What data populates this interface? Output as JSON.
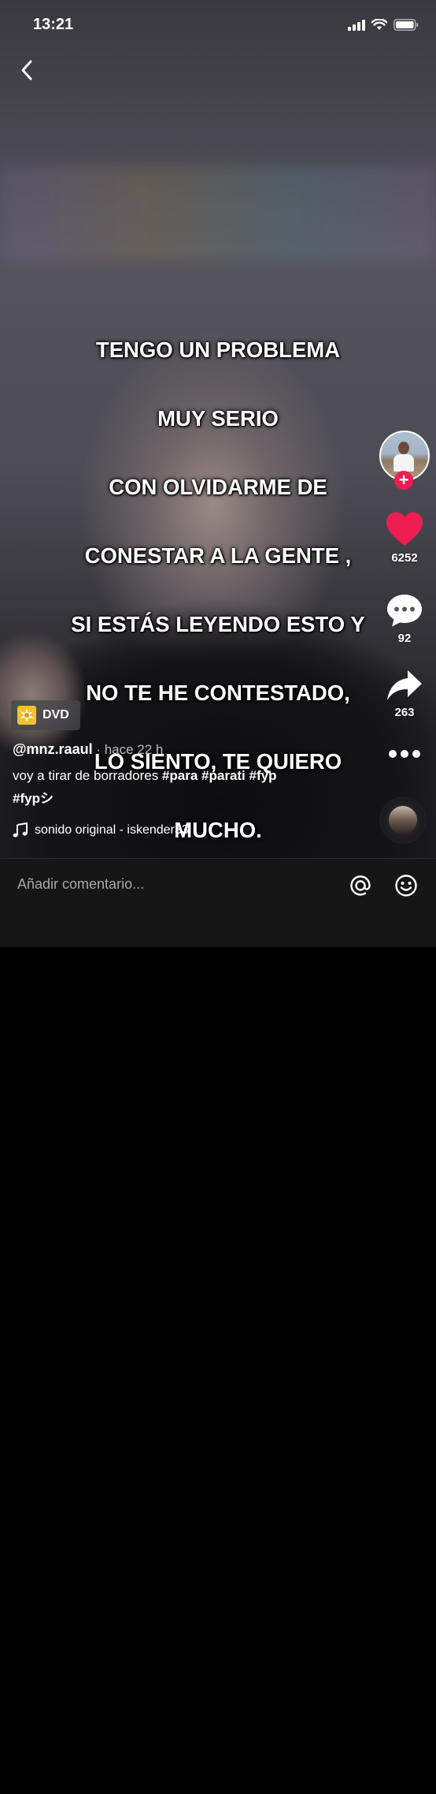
{
  "status_bar": {
    "time": "13:21"
  },
  "caption": {
    "lines": [
      "TENGO UN PROBLEMA",
      "MUY SERIO",
      "CON OLVIDARME DE",
      "CONESTAR A LA GENTE ,",
      "SI ESTÁS LEYENDO ESTO Y",
      "NO TE HE CONTESTADO,",
      "LO SIENTO, TE QUIERO",
      "MUCHO."
    ]
  },
  "sidebar": {
    "follow_symbol": "+",
    "likes_count": "6252",
    "comments_count": "92",
    "shares_count": "263",
    "like_color": "#ee1d52"
  },
  "effect": {
    "label": "DVD"
  },
  "post": {
    "username": "@mnz.raaul",
    "separator": " · ",
    "time_ago": "hace 22 h",
    "description_text": "voy a tirar de borradores ",
    "hashtags": [
      "#para",
      "#parati",
      "#fyp",
      "#fypシ"
    ]
  },
  "sound": {
    "label": "sonido original - iskender33"
  },
  "comment_bar": {
    "placeholder": "Añadir comentario..."
  },
  "icons": {
    "back": "chevron-left-icon",
    "like": "heart-icon",
    "comment": "comment-bubble-icon",
    "share": "share-arrow-icon",
    "more": "more-dots-icon",
    "music": "music-note-icon",
    "mention": "at-icon",
    "emoji": "emoji-icon"
  }
}
